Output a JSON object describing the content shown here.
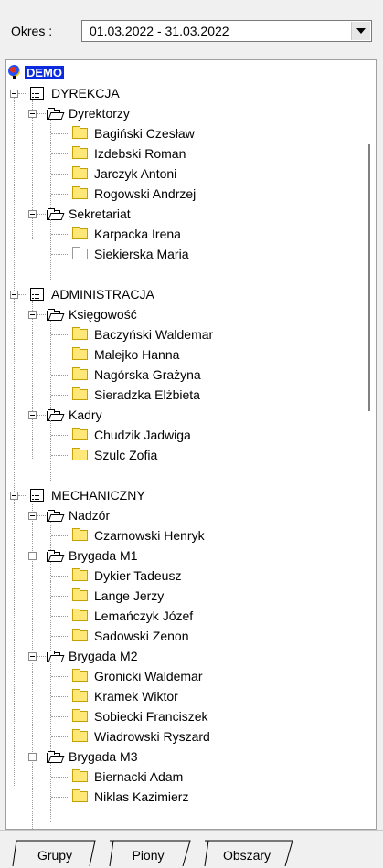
{
  "period": {
    "label": "Okres :",
    "value": "01.03.2022 - 31.03.2022"
  },
  "tree": {
    "root": "DEMO",
    "nodes": [
      {
        "label": "DYREKCJA"
      },
      {
        "label": "Dyrektorzy"
      },
      {
        "label": "Bagiński Czesław"
      },
      {
        "label": "Izdebski Roman"
      },
      {
        "label": "Jarczyk Antoni"
      },
      {
        "label": "Rogowski Andrzej"
      },
      {
        "label": "Sekretariat"
      },
      {
        "label": "Karpacka Irena"
      },
      {
        "label": "Siekierska Maria"
      },
      {
        "label": "ADMINISTRACJA"
      },
      {
        "label": "Księgowość"
      },
      {
        "label": "Baczyński Waldemar"
      },
      {
        "label": "Malejko Hanna"
      },
      {
        "label": "Nagórska Grażyna"
      },
      {
        "label": "Sieradzka Elżbieta"
      },
      {
        "label": "Kadry"
      },
      {
        "label": "Chudzik Jadwiga"
      },
      {
        "label": "Szulc Zofia"
      },
      {
        "label": "MECHANICZNY"
      },
      {
        "label": "Nadzór"
      },
      {
        "label": "Czarnowski Henryk"
      },
      {
        "label": "Brygada M1"
      },
      {
        "label": "Dykier Tadeusz"
      },
      {
        "label": "Lange Jerzy"
      },
      {
        "label": "Lemańczyk Józef"
      },
      {
        "label": "Sadowski Zenon"
      },
      {
        "label": "Brygada M2"
      },
      {
        "label": "Gronicki Waldemar"
      },
      {
        "label": "Kramek Wiktor"
      },
      {
        "label": "Sobiecki Franciszek"
      },
      {
        "label": "Wiadrowski Ryszard"
      },
      {
        "label": "Brygada M3"
      },
      {
        "label": "Biernacki Adam"
      },
      {
        "label": "Niklas Kazimierz"
      }
    ]
  },
  "tabs": [
    {
      "label": "Grupy"
    },
    {
      "label": "Piony"
    },
    {
      "label": "Obszary"
    }
  ],
  "colors": {
    "selection": "#0a2adf",
    "folder": "#ffe878"
  }
}
